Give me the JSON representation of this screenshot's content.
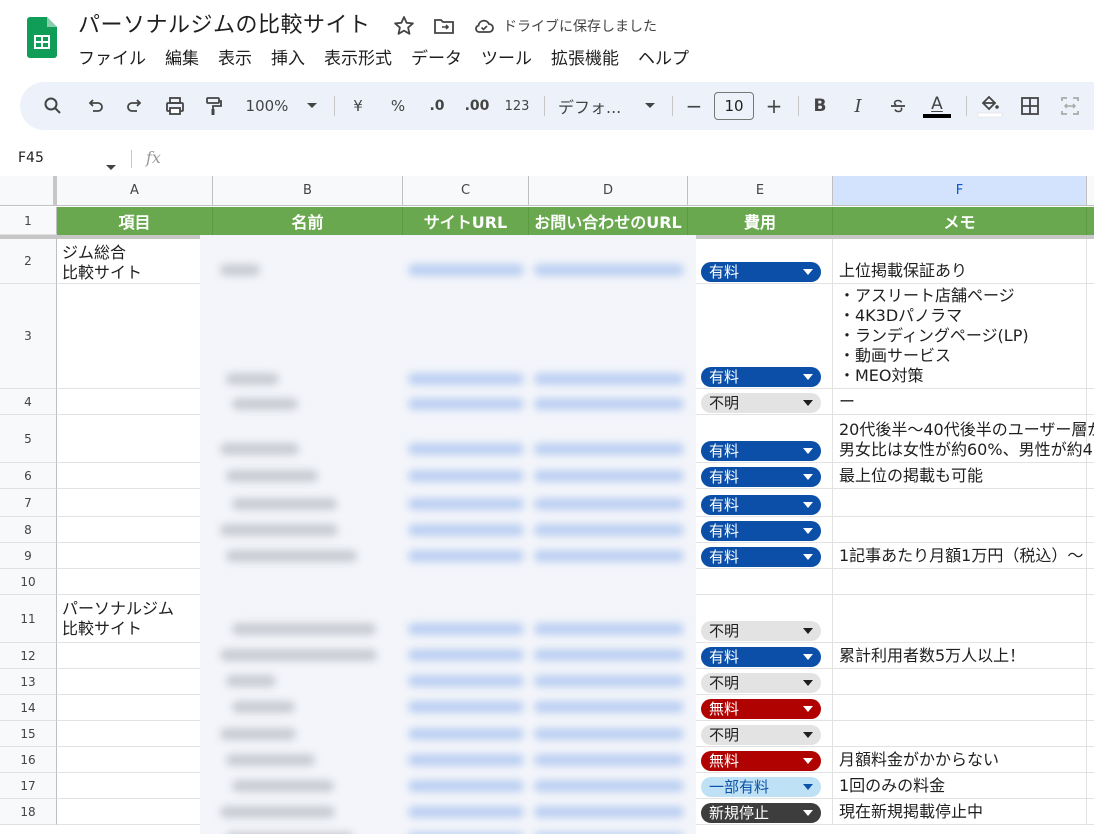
{
  "app": {
    "title": "パーソナルジムの比較サイト",
    "save_status": "ドライブに保存しました",
    "menu": [
      "ファイル",
      "編集",
      "表示",
      "挿入",
      "表示形式",
      "データ",
      "ツール",
      "拡張機能",
      "ヘルプ"
    ]
  },
  "toolbar": {
    "zoom": "100%",
    "currency": "¥",
    "percent": "%",
    "dec_decrease": ".0",
    "dec_increase": ".00",
    "number_format": "123",
    "font": "デフォ...",
    "font_size": "10",
    "minus": "−",
    "plus": "+",
    "bold": "B",
    "italic": "I",
    "text_color": "A"
  },
  "formula_bar": {
    "name_box": "F45",
    "fx": "fx"
  },
  "columns": [
    "A",
    "B",
    "C",
    "D",
    "E",
    "F"
  ],
  "header_row": {
    "number": "1",
    "cells": [
      "項目",
      "名前",
      "サイトURL",
      "お問い合わせのURL",
      "費用",
      "メモ"
    ]
  },
  "rows": [
    {
      "n": "2",
      "a": [
        "ジム総合",
        "比較サイト"
      ],
      "chip": "有料",
      "memo": [
        "上位掲載保証あり"
      ]
    },
    {
      "n": "3",
      "a": [],
      "chip": "有料",
      "memo": [
        "・アスリート店舗ページ",
        "・4K3Dパノラマ",
        "・ランディングページ(LP)",
        "・動画サービス",
        "・MEO対策"
      ]
    },
    {
      "n": "4",
      "a": [],
      "chip": "不明",
      "memo": [
        "ー"
      ]
    },
    {
      "n": "5",
      "a": [],
      "chip": "有料",
      "memo": [
        "20代後半～40代後半のユーザー層が",
        "男女比は女性が約60%、男性が約4"
      ]
    },
    {
      "n": "6",
      "a": [],
      "chip": "有料",
      "memo": [
        "最上位の掲載も可能"
      ]
    },
    {
      "n": "7",
      "a": [],
      "chip": "有料",
      "memo": []
    },
    {
      "n": "8",
      "a": [],
      "chip": "有料",
      "memo": []
    },
    {
      "n": "9",
      "a": [],
      "chip": "有料",
      "memo": [
        "1記事あたり月額1万円（税込）～"
      ]
    },
    {
      "n": "10",
      "a": [],
      "chip": "",
      "memo": []
    },
    {
      "n": "11",
      "a": [
        "パーソナルジム",
        "比較サイト"
      ],
      "chip": "不明",
      "memo": []
    },
    {
      "n": "12",
      "a": [],
      "chip": "有料",
      "memo": [
        "累計利用者数5万人以上！"
      ]
    },
    {
      "n": "13",
      "a": [],
      "chip": "不明",
      "memo": []
    },
    {
      "n": "14",
      "a": [],
      "chip": "無料",
      "memo": []
    },
    {
      "n": "15",
      "a": [],
      "chip": "不明",
      "memo": []
    },
    {
      "n": "16",
      "a": [],
      "chip": "無料",
      "memo": [
        "月額料金がかからない"
      ]
    },
    {
      "n": "17",
      "a": [],
      "chip": "一部有料",
      "memo": [
        "1回のみの料金"
      ]
    },
    {
      "n": "18",
      "a": [],
      "chip": "新規停止",
      "memo": [
        "現在新規掲載停止中"
      ]
    }
  ],
  "chip_styles": {
    "有料": {
      "bg": "#0b4fa8",
      "fg": "#ffffff"
    },
    "不明": {
      "bg": "#e3e3e3",
      "fg": "#1f1f1f"
    },
    "無料": {
      "bg": "#b10202",
      "fg": "#ffffff"
    },
    "一部有料": {
      "bg": "#bfe1f6",
      "fg": "#0a53a8"
    },
    "新規停止": {
      "bg": "#3d3d3d",
      "fg": "#ffffff"
    }
  },
  "colors": {
    "header_green": "#6aa84f",
    "selected_column": "#d3e3fd",
    "toolbar_bg": "#edf2fa"
  }
}
